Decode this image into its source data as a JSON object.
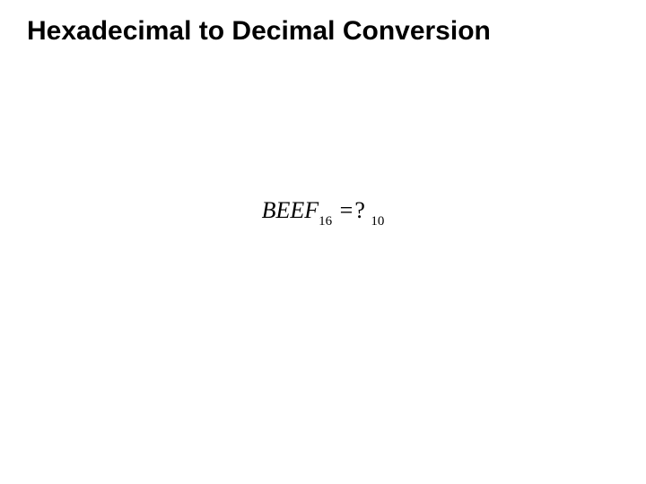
{
  "title": "Hexadecimal to Decimal Conversion",
  "equation": {
    "lhs_value": "BEEF",
    "lhs_base": "16",
    "equals": " =",
    "rhs_value": "?",
    "rhs_base": "10",
    "rhs_space": " "
  }
}
